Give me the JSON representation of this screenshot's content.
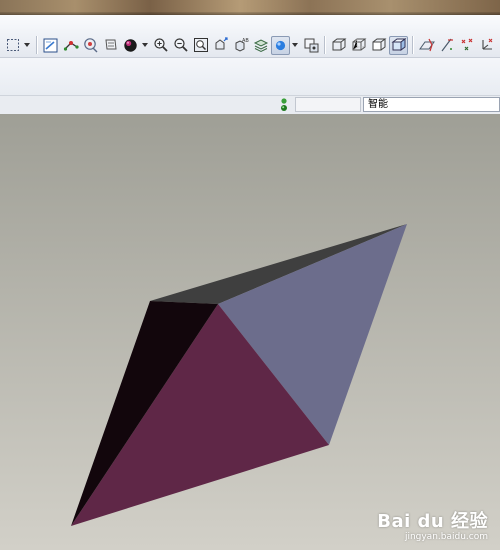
{
  "toolbar": {
    "buttons": [
      {
        "icon": "box-select-icon",
        "pressed": false
      },
      {
        "icon": "dropdown-arrow-icon",
        "pressed": false
      },
      {
        "icon": "sketch-view-icon",
        "pressed": false
      },
      {
        "icon": "datum-axis-icon",
        "pressed": false
      },
      {
        "icon": "spin-center-icon",
        "pressed": false
      },
      {
        "icon": "repaint-icon",
        "pressed": false
      },
      {
        "icon": "appearance-sphere-icon",
        "pressed": false
      },
      {
        "icon": "zoom-in-icon",
        "pressed": false
      },
      {
        "icon": "zoom-out-icon",
        "pressed": false
      },
      {
        "icon": "refit-icon",
        "pressed": false
      },
      {
        "icon": "orient-icon",
        "pressed": false
      },
      {
        "icon": "saved-views-icon",
        "pressed": false
      },
      {
        "icon": "layers-icon",
        "pressed": false
      },
      {
        "icon": "display-style-icon",
        "pressed": true
      },
      {
        "icon": "view-manager-icon",
        "pressed": false
      },
      {
        "icon": "wireframe-icon",
        "pressed": false
      },
      {
        "icon": "hidden-line-icon",
        "pressed": false
      },
      {
        "icon": "no-hidden-icon",
        "pressed": false
      },
      {
        "icon": "shading-icon",
        "pressed": true
      },
      {
        "icon": "datum-plane-icon",
        "pressed": false
      },
      {
        "icon": "datum-axis-display-icon",
        "pressed": false
      },
      {
        "icon": "datum-point-icon",
        "pressed": false
      },
      {
        "icon": "coordinate-system-icon",
        "pressed": false
      }
    ]
  },
  "status": {
    "filter_value": "智能"
  },
  "viewport": {
    "background_top": "#9f9f96",
    "background_bottom": "#d2d0c8",
    "faces": {
      "top": "#3f3f3f",
      "right": "#6c6d8c",
      "front": "#5f2747",
      "left": "#12060c"
    }
  },
  "watermark": {
    "logo": "Bai du 经验",
    "url": "jingyan.baidu.com"
  }
}
